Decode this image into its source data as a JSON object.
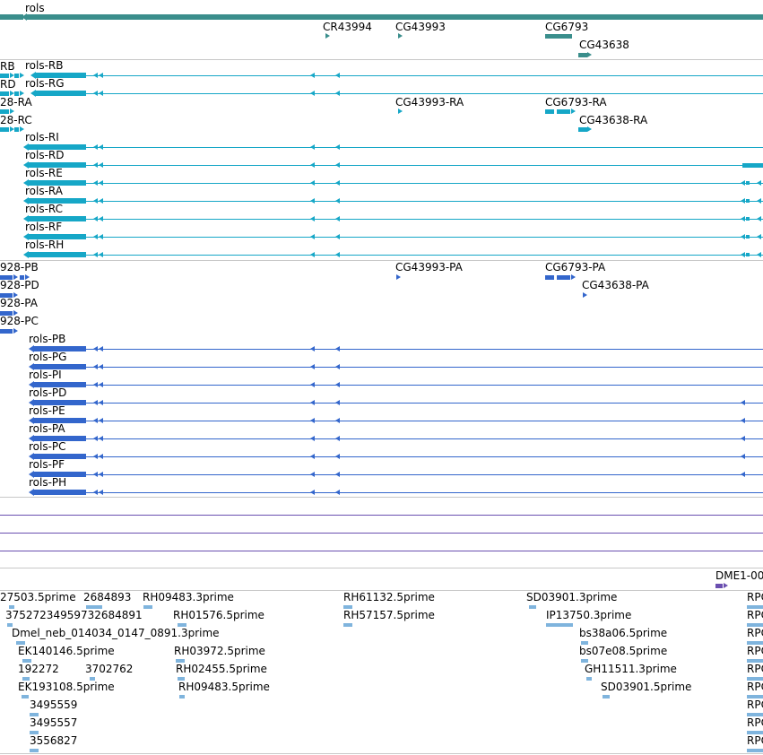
{
  "colors": {
    "gene": "#3a8e8c",
    "transcript": "#16a7c7",
    "protein": "#3366cc",
    "est": "#7fb4dd",
    "other_line": "#6a4fb0",
    "divider": "#c8c8c8"
  },
  "tracks": {
    "genes": [
      "rols",
      "CR43994",
      "CG43993",
      "CG6793",
      "CG43638"
    ],
    "transcripts": [
      "RB",
      "rols-RB",
      "RD",
      "rols-RG",
      "28-RA",
      "CG43993-RA",
      "CG6793-RA",
      "28-RC",
      "CG43638-RA",
      "rols-RI",
      "rols-RD",
      "rols-RE",
      "rols-RA",
      "rols-RC",
      "rols-RF",
      "rols-RH"
    ],
    "proteins": [
      "928-PB",
      "CG43993-PA",
      "CG6793-PA",
      "928-PD",
      "CG43638-PA",
      "928-PA",
      "928-PC",
      "rols-PB",
      "rols-PG",
      "rols-PI",
      "rols-PD",
      "rols-PE",
      "rols-PA",
      "rols-PC",
      "rols-PF",
      "rols-PH"
    ],
    "other": [
      "DME1-00"
    ],
    "ests": [
      "27503.5prime",
      "2684893",
      "RH09483.3prime",
      "RH61132.5prime",
      "SD03901.3prime",
      "RPC",
      "37527234959732684891",
      "RH01576.5prime",
      "RH57157.5prime",
      "IP13750.3prime",
      "RPC",
      "Dmel_neb_014034_0147_0891.3prime",
      "bs38a06.5prime",
      "RPC",
      "EK140146.5prime",
      "RH03972.5prime",
      "bs07e08.5prime",
      "RPC",
      "192272",
      "3702762",
      "RH02455.5prime",
      "GH11511.3prime",
      "RPC",
      "EK193108.5prime",
      "RH09483.5prime",
      "SD03901.5prime",
      "RPC",
      "3495559",
      "RPC",
      "3495557",
      "RPC",
      "3556827",
      "RPC"
    ]
  }
}
